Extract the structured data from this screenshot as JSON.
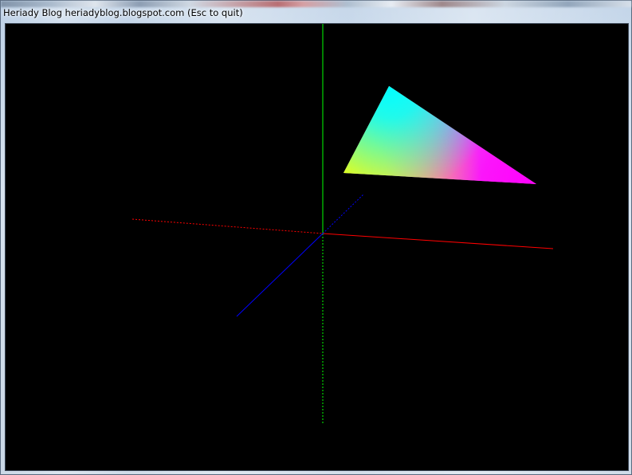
{
  "window": {
    "title": "Heriady Blog heriadyblog.blogspot.com (Esc to quit)"
  },
  "scene": {
    "background_color": "#000000",
    "axes": {
      "x_axis_color": "#ff0000",
      "y_axis_color": "#00ff00",
      "z_axis_color": "#0000ff"
    },
    "triangle": {
      "vertex_colors": [
        "#00ffff",
        "#ffff00",
        "#ff00ff"
      ]
    }
  }
}
